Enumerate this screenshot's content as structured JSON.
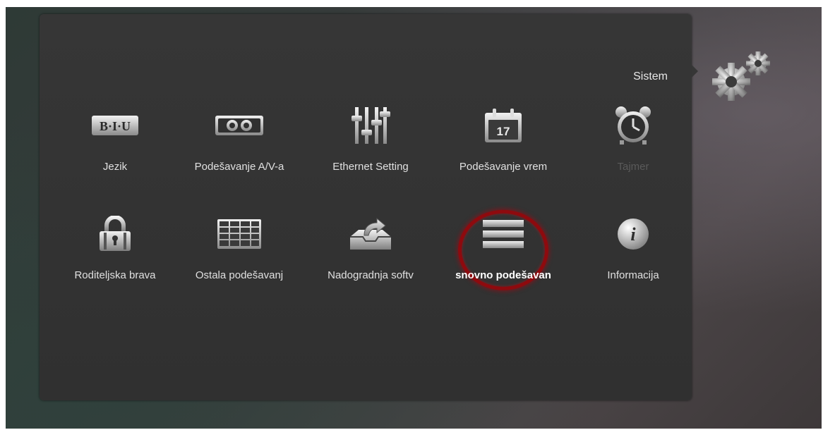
{
  "menu": {
    "title": "Sistem",
    "items": [
      {
        "label": "Jezik",
        "icon": "language-biu-icon",
        "state": "normal"
      },
      {
        "label": "Podešavanje A/V-a",
        "icon": "av-settings-icon",
        "state": "normal"
      },
      {
        "label": "Ethernet Setting",
        "icon": "equalizer-sliders-icon",
        "state": "normal"
      },
      {
        "label": "Podešavanje vrem",
        "icon": "calendar-icon",
        "calendar_day": "17",
        "state": "normal"
      },
      {
        "label": "Tajmer",
        "icon": "alarm-clock-icon",
        "state": "disabled"
      },
      {
        "label": "Roditeljska brava",
        "icon": "padlock-icon",
        "state": "normal"
      },
      {
        "label": "Ostala podešavanj",
        "icon": "grid-table-icon",
        "state": "normal"
      },
      {
        "label": "Nadogradnja softv",
        "icon": "upgrade-tray-icon",
        "state": "normal"
      },
      {
        "label": "snovno podešavan",
        "icon": "factory-reset-icon",
        "state": "selected"
      },
      {
        "label": "Informacija",
        "icon": "info-icon",
        "state": "normal"
      }
    ]
  },
  "colors": {
    "selection_ring": "#8e0a0e",
    "label": "#e0e0e0",
    "disabled_label": "#5a5a5a"
  }
}
